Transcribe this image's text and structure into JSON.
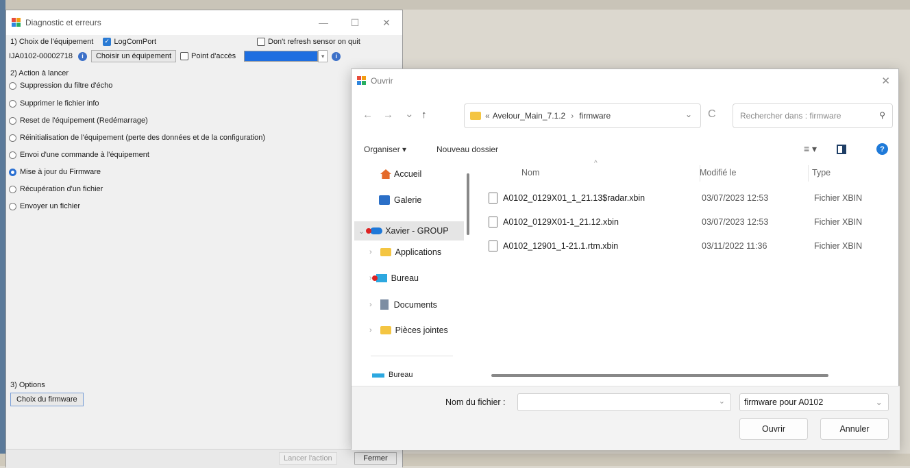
{
  "diag": {
    "title": "Diagnostic et erreurs",
    "minimize": "—",
    "maximize": "☐",
    "close": "✕",
    "section1": "1) Choix de l'équipement",
    "logcomport": "LogComPort",
    "dont_refresh": "Don't refresh sensor on quit",
    "device_id": "IJA0102-00002718",
    "choose_device": "Choisir un équipement",
    "access_point": "Point d'accès",
    "section2": "2) Action à lancer",
    "actions": [
      "Suppression du filtre d'écho",
      "Supprimer le fichier info",
      "Reset de l'équipement (Redémarrage)",
      "Réinitialisation de l'équipement (perte des données et de la configuration)",
      "Envoi d'une commande à l'équipement",
      "Mise à jour du Firmware",
      "Récupération d'un fichier",
      "Envoyer un fichier"
    ],
    "selected_action_index": 5,
    "section3": "3) Options",
    "firmware_choice": "Choix du firmware",
    "run_action": "Lancer l'action",
    "close_btn": "Fermer"
  },
  "open_dialog": {
    "title": "Ouvrir",
    "close": "✕",
    "nav": {
      "back": "←",
      "forward": "→",
      "recent": "⌄",
      "up": "↑"
    },
    "path_prefix": "«",
    "path_parts": [
      "Avelour_Main_7.1.2",
      "firmware"
    ],
    "path_sep": "›",
    "refresh": "C",
    "path_dropdown": "⌄",
    "search_placeholder": "Rechercher dans : firmware",
    "toolbar": {
      "organize": "Organiser ▾",
      "new_folder": "Nouveau dossier",
      "view": "≡ ▾",
      "help": "?"
    },
    "sidebar": [
      {
        "label": "Accueil",
        "icon": "home-icon",
        "chevron": ""
      },
      {
        "label": "Galerie",
        "icon": "gallery-icon",
        "chevron": ""
      },
      {
        "label": "Xavier - GROUP",
        "icon": "onedrive-icon",
        "chevron": "⌄"
      },
      {
        "label": "Applications",
        "icon": "folder-icon",
        "chevron": "›"
      },
      {
        "label": "Bureau",
        "icon": "desktop-icon",
        "chevron": "›"
      },
      {
        "label": "Documents",
        "icon": "documents-icon",
        "chevron": "›"
      },
      {
        "label": "Pièces jointes",
        "icon": "folder-icon",
        "chevron": "›"
      },
      {
        "label": "Bureau",
        "icon": "desktop-icon",
        "chevron": ""
      }
    ],
    "columns": {
      "name": "Nom",
      "modified": "Modifié le",
      "type": "Type",
      "sort_arrow": "^"
    },
    "files": [
      {
        "name": "A0102_0129X01_1_21.13$radar.xbin",
        "modified": "03/07/2023 12:53",
        "type": "Fichier XBIN"
      },
      {
        "name": "A0102_0129X01-1_21.12.xbin",
        "modified": "03/07/2023 12:53",
        "type": "Fichier XBIN"
      },
      {
        "name": "A0102_12901_1-21.1.rtm.xbin",
        "modified": "03/11/2022 11:36",
        "type": "Fichier XBIN"
      }
    ],
    "filename_label": "Nom du fichier :",
    "filename_value": "",
    "filetype": "firmware pour A0102",
    "open_btn": "Ouvrir",
    "cancel_btn": "Annuler"
  }
}
